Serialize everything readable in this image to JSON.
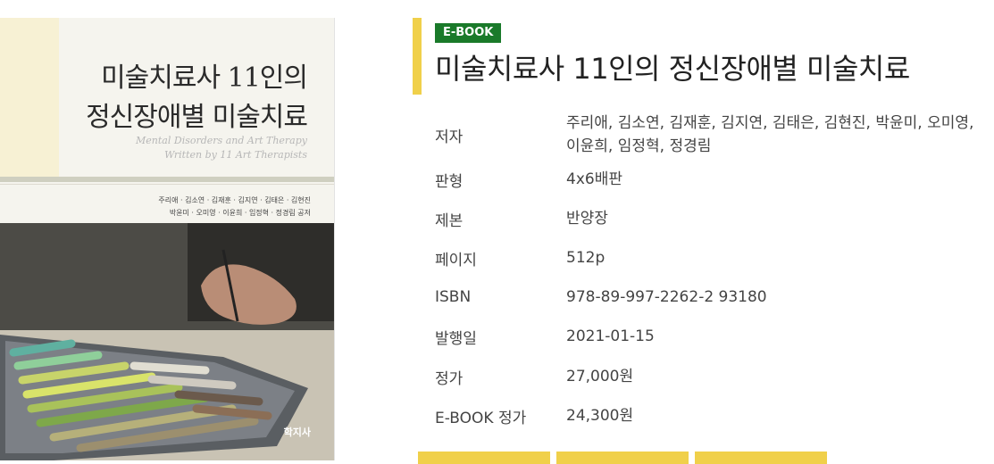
{
  "cover": {
    "title_line1": "미술치료사 11인의",
    "title_line2": "정신장애별 미술치료",
    "subtitle_line1": "Mental Disorders and Art Therapy",
    "subtitle_line2": "Written by 11 Art Therapists",
    "authors_line1": "주리애 · 김소연 · 김재훈 · 김지연 · 김태은 · 김현진",
    "authors_line2": "박윤미 · 오미영 · 이윤희 · 임정혁 · 정경림 공저",
    "publisher": "학지사"
  },
  "badge": "E-BOOK",
  "title": "미술치료사 11인의 정신장애별 미술치료",
  "info": [
    {
      "label": "저자",
      "value": "주리애, 김소연, 김재훈, 김지연, 김태은, 김현진, 박윤미, 오미영, 이윤희, 임정혁, 정경림"
    },
    {
      "label": "판형",
      "value": "4x6배판"
    },
    {
      "label": "제본",
      "value": "반양장"
    },
    {
      "label": "페이지",
      "value": "512p"
    },
    {
      "label": "ISBN",
      "value": "978-89-997-2262-2 93180"
    },
    {
      "label": "발행일",
      "value": "2021-01-15"
    },
    {
      "label": "정가",
      "value": "27,000원"
    },
    {
      "label": "E-BOOK 정가",
      "value": "24,300원"
    }
  ],
  "colors": {
    "accent": "#f0d04a",
    "badge": "#1a7a2a"
  }
}
